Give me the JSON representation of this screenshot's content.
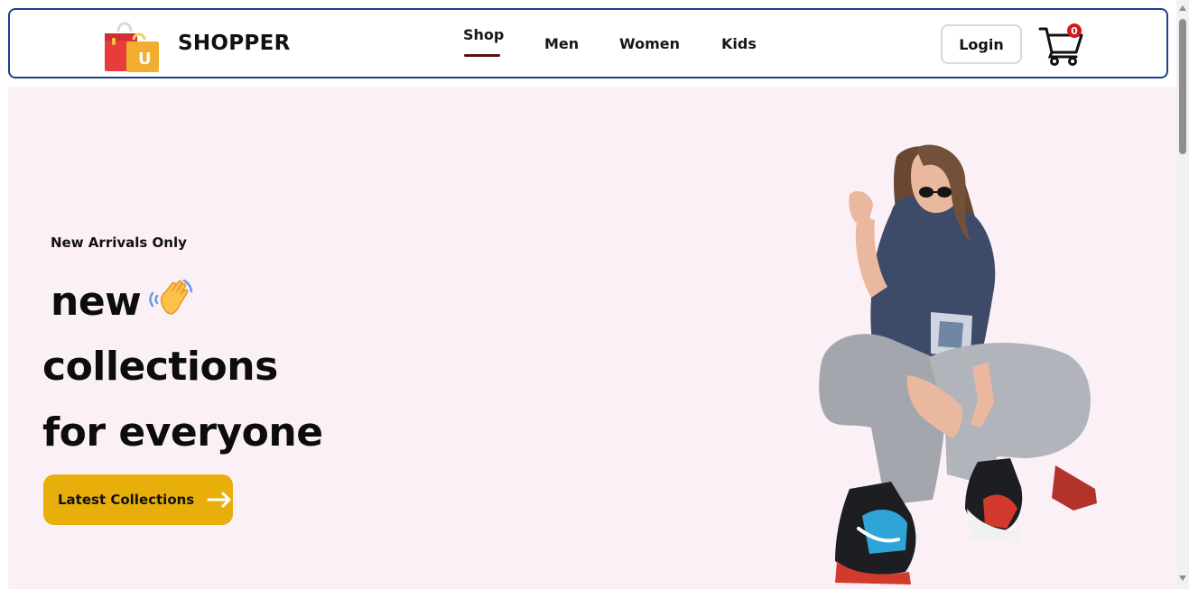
{
  "header": {
    "brand": "SHOPPER",
    "nav": [
      "Shop",
      "Men",
      "Women",
      "Kids"
    ],
    "active_nav": "Shop",
    "login_label": "Login",
    "cart_count": "0",
    "logo_letter": "U"
  },
  "hero": {
    "subtitle": "New Arrivals Only",
    "line1": "new",
    "line2": "collections",
    "line3": "for everyone",
    "cta_label": "Latest Collections"
  },
  "colors": {
    "navbar_border": "#1d3f8f",
    "hero_background": "#fcf0f7",
    "cta_background": "#e8af0a",
    "active_underline": "#5a0f13",
    "cart_badge": "#d11a1a"
  },
  "icons": [
    "shopping-bags-logo-icon",
    "cart-icon",
    "waving-hand-icon",
    "arrow-right-icon"
  ]
}
